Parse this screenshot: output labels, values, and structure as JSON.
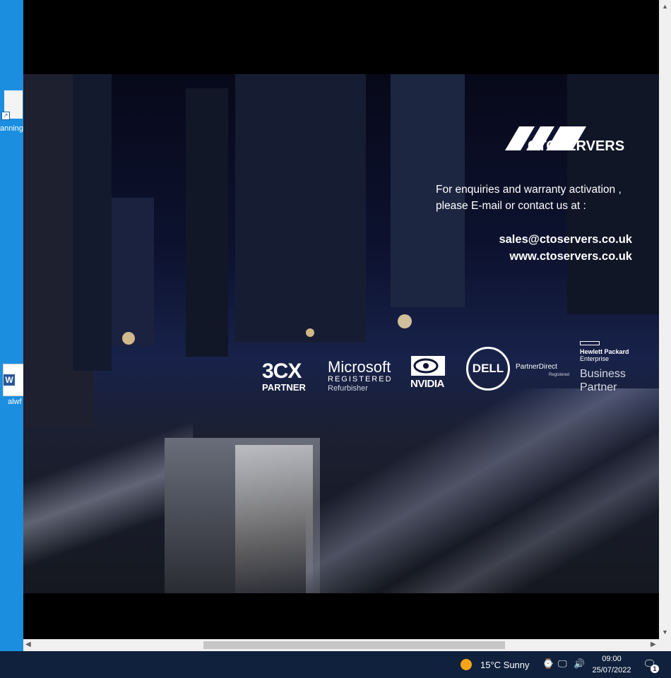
{
  "desktop": {
    "icon1_label": "anning",
    "icon2_label": "alwf",
    "word_letter": "W",
    "shortcut_glyph": "↗"
  },
  "image": {
    "brand": "CTOSERVERS",
    "enquiry_line1": "For enquiries and warranty activation ,",
    "enquiry_line2": "please E-mail or contact us at :",
    "email": "sales@ctoservers.co.uk",
    "website": "www.ctoservers.co.uk",
    "logos": {
      "threecx": "3CX",
      "threecx_sub": "PARTNER",
      "microsoft": "Microsoft",
      "microsoft_sub": "REGISTERED",
      "microsoft_sub2": "Refurbisher",
      "nvidia": "NVIDIA",
      "dell": "DELL",
      "dell_partner": "PartnerDirect",
      "dell_partner_sub": "Registered",
      "hpe_line1": "Hewlett Packard",
      "hpe_line2": "Enterprise",
      "hpe_bp1": "Business",
      "hpe_bp2": "Partner"
    }
  },
  "scrollbars": {
    "up": "▲",
    "down": "▼",
    "left": "◀",
    "right": "▶"
  },
  "taskbar": {
    "weather": "15°C  Sunny",
    "time": "09:00",
    "date": "25/07/2022",
    "notification_count": "1",
    "icons": [
      "weather-sun-icon",
      "meet-now-icon",
      "network-icon",
      "volume-icon",
      "notification-icon"
    ]
  },
  "colors": {
    "desktop": "#1b8ee0",
    "taskbar": "#10213d",
    "weather_sun": "#f6a516"
  }
}
